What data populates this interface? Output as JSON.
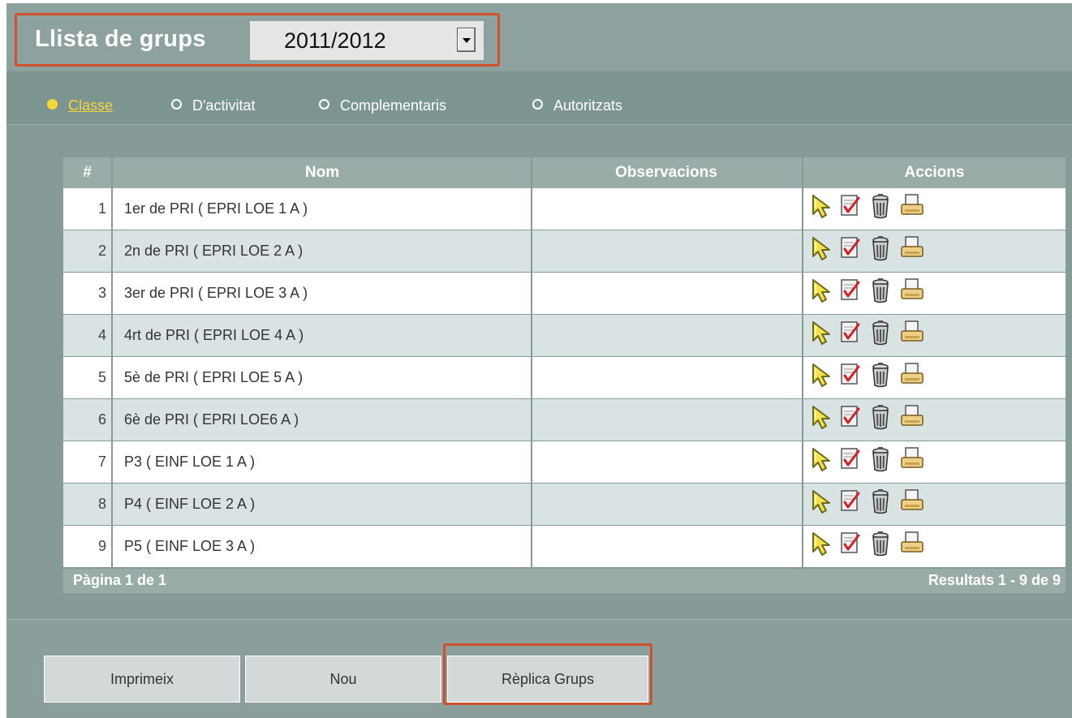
{
  "header": {
    "title": "Llista de grups",
    "year_select": {
      "value": "2011/2012"
    }
  },
  "filters": [
    {
      "label": "Classe",
      "selected": true
    },
    {
      "label": "D'activitat",
      "selected": false
    },
    {
      "label": "Complementaris",
      "selected": false
    },
    {
      "label": "Autoritzats",
      "selected": false
    }
  ],
  "table": {
    "columns": [
      "#",
      "Nom",
      "Observacions",
      "Accions"
    ],
    "rows": [
      {
        "num": "1",
        "nom": "1er de PRI ( EPRI LOE 1 A )",
        "obs": ""
      },
      {
        "num": "2",
        "nom": "2n de PRI ( EPRI LOE 2 A )",
        "obs": ""
      },
      {
        "num": "3",
        "nom": "3er de PRI ( EPRI LOE 3 A )",
        "obs": ""
      },
      {
        "num": "4",
        "nom": "4rt de PRI ( EPRI LOE 4 A )",
        "obs": ""
      },
      {
        "num": "5",
        "nom": "5è de PRI ( EPRI LOE 5 A )",
        "obs": ""
      },
      {
        "num": "6",
        "nom": "6è de PRI ( EPRI LOE6 A )",
        "obs": ""
      },
      {
        "num": "7",
        "nom": "P3 ( EINF LOE 1 A )",
        "obs": ""
      },
      {
        "num": "8",
        "nom": "P4 ( EINF LOE 2 A )",
        "obs": ""
      },
      {
        "num": "9",
        "nom": "P5 ( EINF LOE 3 A )",
        "obs": ""
      }
    ],
    "row_actions": [
      "select-icon",
      "edit-icon",
      "delete-icon",
      "print-icon"
    ],
    "footer": {
      "page": "Pàgina 1 de 1",
      "results": "Resultats 1 - 9 de 9"
    }
  },
  "buttons": {
    "print": "Imprimeix",
    "new": "Nou",
    "replicate": "Rèplica Grups"
  },
  "colors": {
    "panel": "#869b97",
    "header_row": "#9aaca8",
    "row_alt": "#d9e3e3",
    "highlight": "#d0502e",
    "selected_radio": "#f5d838"
  }
}
